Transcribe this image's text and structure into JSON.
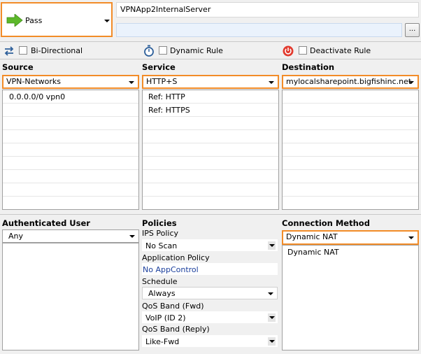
{
  "action": {
    "label": "Pass",
    "icon": "green-arrow-right-icon",
    "accent": "#f28c28",
    "arrow_color": "#5db82a"
  },
  "rule_name": {
    "value": "VPNApp2InternalServer"
  },
  "comment": {
    "value": "",
    "button_label": "..."
  },
  "options": {
    "bidirectional": "Bi-Directional",
    "dynamic_rule": "Dynamic Rule",
    "deactivate_rule": "Deactivate Rule"
  },
  "source": {
    "title": "Source",
    "selected": "VPN-Networks",
    "items": [
      "0.0.0.0/0 vpn0"
    ]
  },
  "service": {
    "title": "Service",
    "selected": "HTTP+S",
    "items": [
      "Ref: HTTP",
      "Ref: HTTPS"
    ]
  },
  "destination": {
    "title": "Destination",
    "selected": "mylocalsharepoint.bigfishinc.net",
    "items": []
  },
  "authenticated_user": {
    "title": "Authenticated User",
    "selected": "Any"
  },
  "policies": {
    "title": "Policies",
    "ips_label": "IPS Policy",
    "ips_value": "No Scan",
    "app_label": "Application Policy",
    "app_value": "No AppControl",
    "schedule_label": "Schedule",
    "schedule_value": "Always",
    "qos_fwd_label": "QoS Band (Fwd)",
    "qos_fwd_value": "VoIP (ID 2)",
    "qos_reply_label": "QoS Band (Reply)",
    "qos_reply_value": "Like-Fwd"
  },
  "connection_method": {
    "title": "Connection Method",
    "selected": "Dynamic NAT",
    "items": [
      "Dynamic NAT"
    ]
  }
}
